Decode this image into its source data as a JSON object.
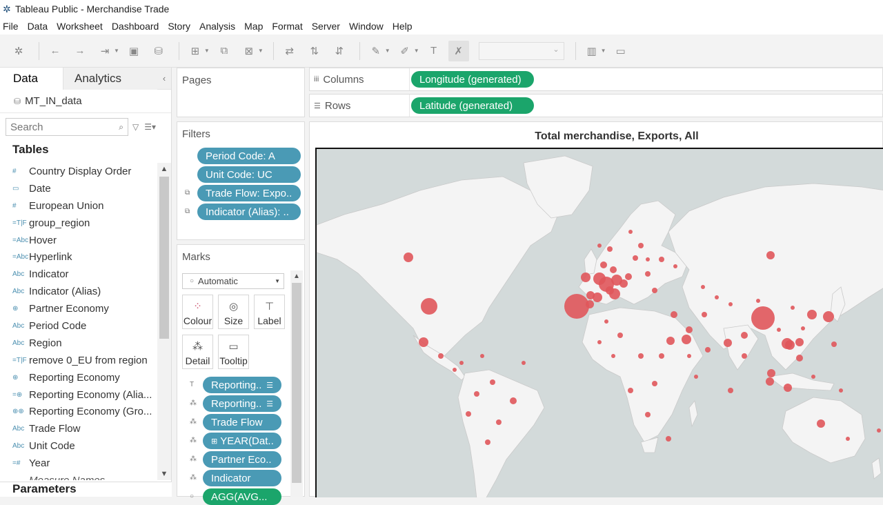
{
  "window": {
    "title": "Tableau Public - Merchandise Trade"
  },
  "menu": [
    "File",
    "Data",
    "Worksheet",
    "Dashboard",
    "Story",
    "Analysis",
    "Map",
    "Format",
    "Server",
    "Window",
    "Help"
  ],
  "data_pane": {
    "tab_data": "Data",
    "tab_analytics": "Analytics",
    "datasource": "MT_IN_data",
    "search_placeholder": "Search",
    "tables_heading": "Tables",
    "parameters_heading": "Parameters",
    "fields": [
      {
        "icon": "#",
        "label": "Country Display Order"
      },
      {
        "icon": "▭",
        "label": "Date"
      },
      {
        "icon": "#",
        "label": "European Union"
      },
      {
        "icon": "=T|F",
        "label": "group_region"
      },
      {
        "icon": "=Abc",
        "label": "Hover"
      },
      {
        "icon": "=Abc",
        "label": "Hyperlink"
      },
      {
        "icon": "Abc",
        "label": "Indicator"
      },
      {
        "icon": "Abc",
        "label": "Indicator (Alias)"
      },
      {
        "icon": "⊕",
        "label": "Partner Economy"
      },
      {
        "icon": "Abc",
        "label": "Period Code"
      },
      {
        "icon": "Abc",
        "label": "Region"
      },
      {
        "icon": "=T|F",
        "label": "remove 0_EU from region"
      },
      {
        "icon": "⊕",
        "label": "Reporting Economy"
      },
      {
        "icon": "=⊕",
        "label": "Reporting Economy (Alia..."
      },
      {
        "icon": "⊕⊕",
        "label": "Reporting Economy (Gro..."
      },
      {
        "icon": "Abc",
        "label": "Trade Flow"
      },
      {
        "icon": "Abc",
        "label": "Unit Code"
      },
      {
        "icon": "=#",
        "label": "Year"
      },
      {
        "icon": "",
        "label": "Measure Names"
      }
    ]
  },
  "pages": {
    "title": "Pages"
  },
  "filters": {
    "title": "Filters",
    "items": [
      "Period Code: A",
      "Unit Code: UC",
      "Trade Flow: Expo..",
      "Indicator (Alias): .."
    ]
  },
  "marks": {
    "title": "Marks",
    "type": "Automatic",
    "buttons": {
      "colour": "Colour",
      "size": "Size",
      "label": "Label",
      "detail": "Detail",
      "tooltip": "Tooltip"
    },
    "pills": [
      "Reporting..",
      "Reporting..",
      "Trade Flow",
      "YEAR(Dat..",
      "Partner Eco..",
      "Indicator",
      "AGG(AVG..."
    ]
  },
  "shelves": {
    "columns_label": "Columns",
    "columns_pill": "Longitude (generated)",
    "rows_label": "Rows",
    "rows_pill": "Latitude (generated)"
  },
  "view": {
    "title": "Total merchandise, Exports, All",
    "map_colors": {
      "ocean": "#d3dada",
      "land": "#f4f4f4",
      "border": "#c9c9c9",
      "mark": "#e0575b"
    }
  }
}
